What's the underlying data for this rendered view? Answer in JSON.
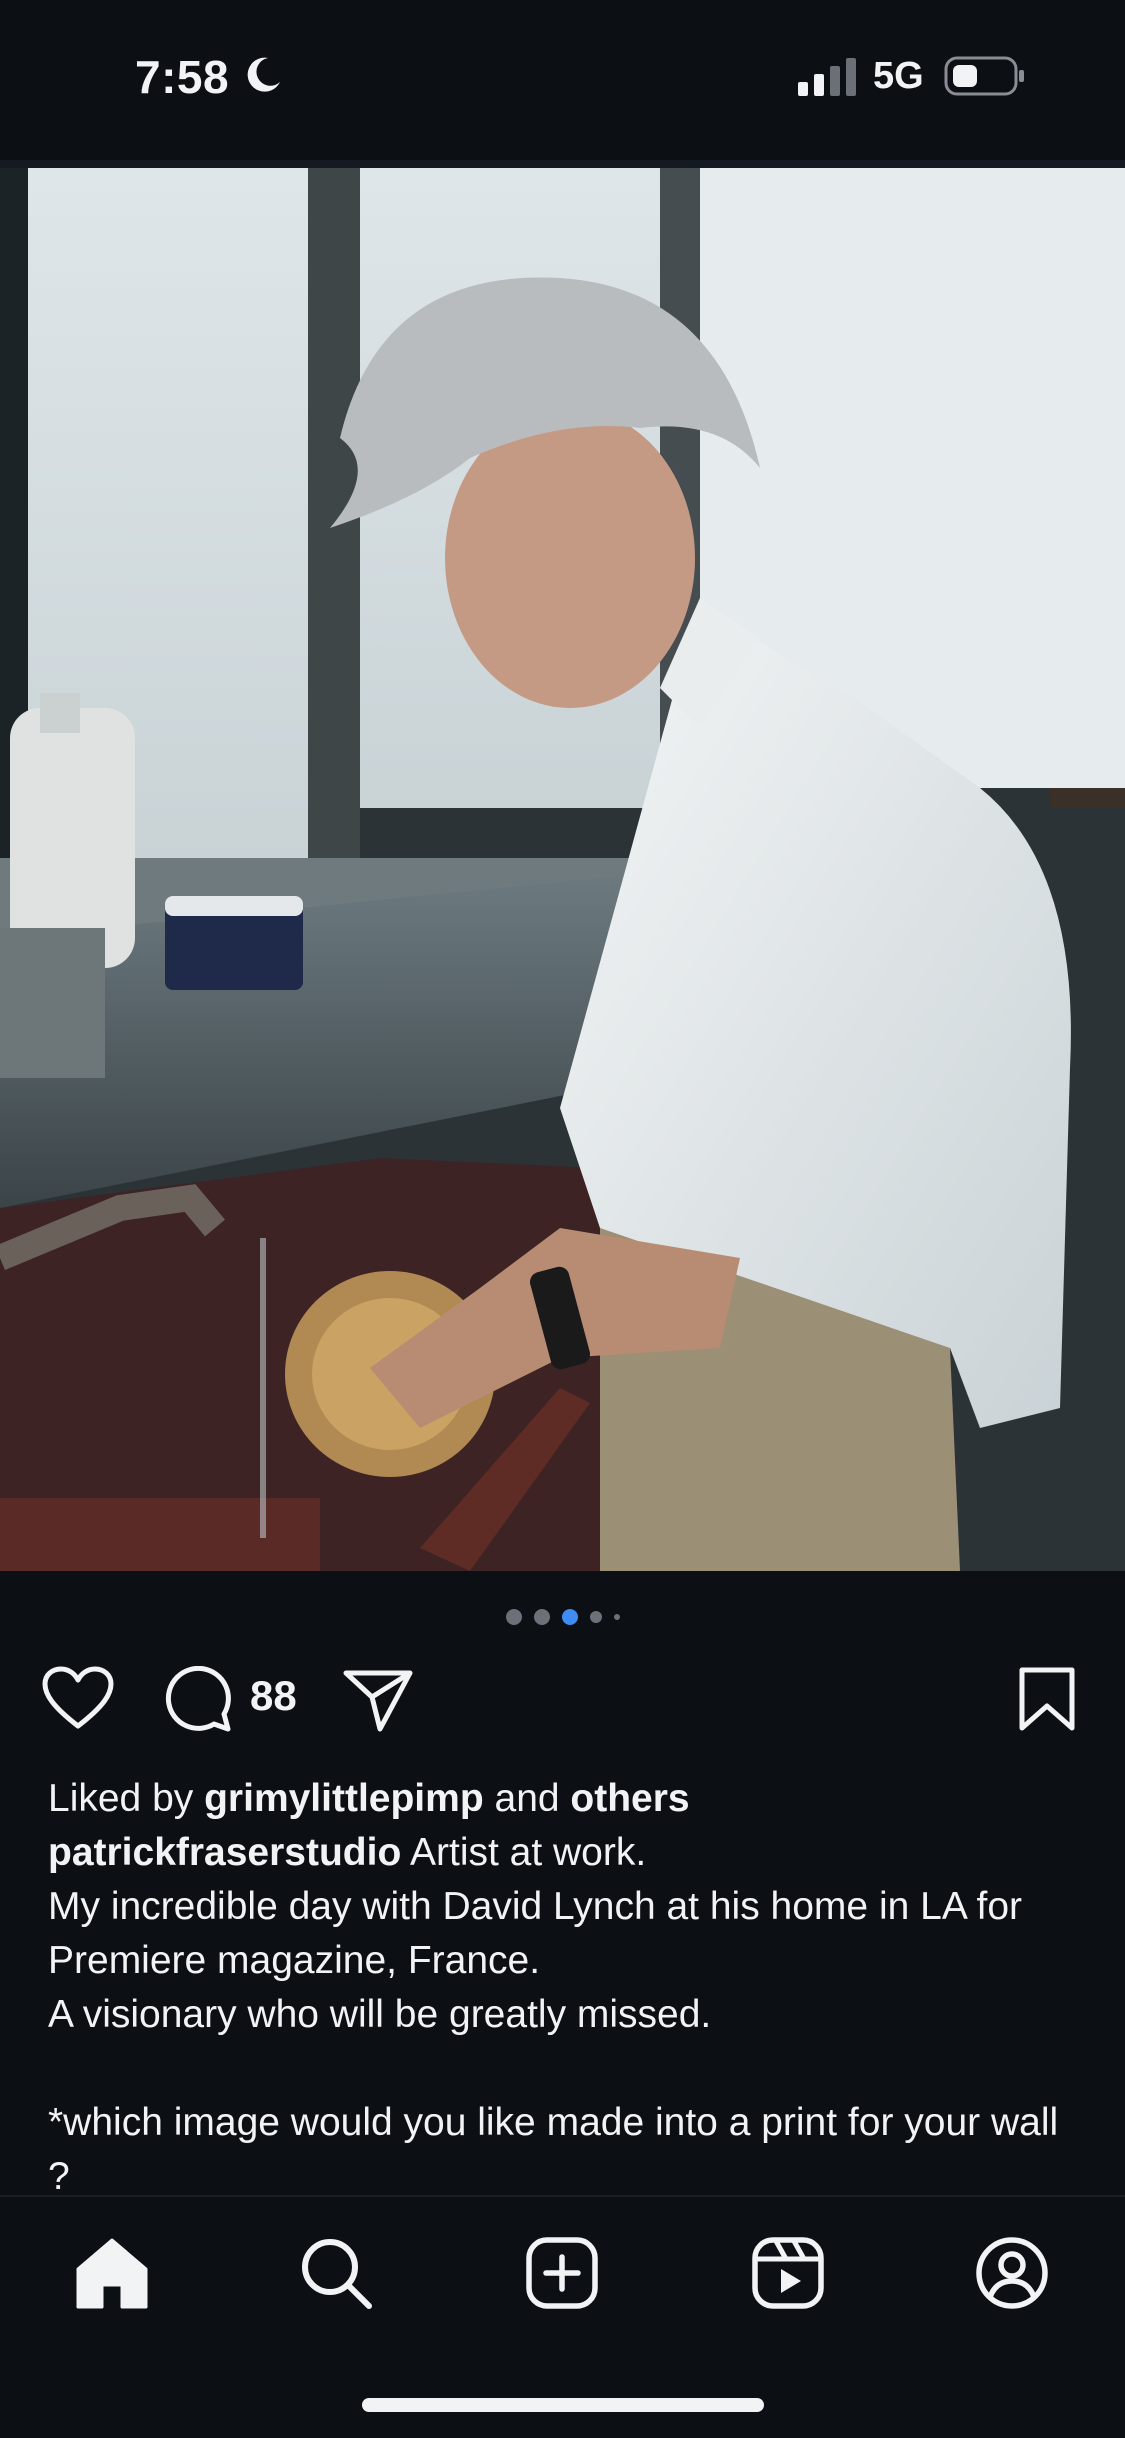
{
  "status_bar": {
    "time": "7:58",
    "network": "5G",
    "icons": [
      "moon-icon",
      "signal-icon",
      "battery-icon"
    ]
  },
  "post": {
    "image_icons": [
      "mute-icon"
    ],
    "carousel": {
      "total_dots": 5,
      "active_index": 2
    },
    "actions": {
      "comment_count": "88",
      "icons": [
        "heart-icon",
        "comment-icon",
        "share-icon",
        "bookmark-icon"
      ]
    },
    "likes": {
      "prefix": "Liked by",
      "user": "grimylittlepimp",
      "middle": "and",
      "suffix": "others"
    },
    "caption": {
      "username": "patrickfraserstudio",
      "line1": "Artist at work.",
      "line2": "My incredible day with David Lynch at his home in LA for Premiere magazine, France.",
      "line3": "A visionary who will be greatly missed.",
      "line4": "*which image would you like made into a print for your wall ?"
    }
  },
  "tab_bar": {
    "tabs": [
      "home-icon",
      "search-icon",
      "create-icon",
      "reels-icon",
      "profile-icon"
    ],
    "active": "home-icon"
  },
  "colors": {
    "background": "#0c0f14",
    "text": "#f2f3f5",
    "active_dot": "#3f8cf2",
    "inactive_dot": "#6b7079"
  }
}
